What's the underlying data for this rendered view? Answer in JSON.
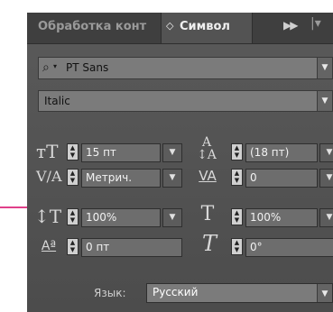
{
  "tabs": {
    "inactive_label": "Обработка конт",
    "active_label": "Символ",
    "active_arrows": "◇",
    "more": "▶▶",
    "menu": "|▾"
  },
  "font": {
    "family": "PT Sans",
    "style": "Italic"
  },
  "size": {
    "value": "15 пт"
  },
  "leading": {
    "value": "(18 пт)"
  },
  "kerning": {
    "value": "Метрич."
  },
  "tracking": {
    "value": "0"
  },
  "vertical_scale": {
    "value": "100%"
  },
  "horizontal_scale": {
    "value": "100%"
  },
  "baseline_shift": {
    "value": "0 пт"
  },
  "skew": {
    "value": "0°"
  },
  "language": {
    "label": "Язык:",
    "value": "Русский"
  },
  "icons": {
    "size": "font-size-icon",
    "leading": "leading-icon",
    "kerning": "kerning-icon",
    "tracking": "tracking-icon",
    "vertical_scale": "vertical-scale-icon",
    "horizontal_scale": "horizontal-scale-icon",
    "baseline": "baseline-shift-icon",
    "skew": "skew-icon"
  },
  "colors": {
    "panel_bg": "#535353",
    "tab_bar": "#3f3f3f",
    "field_bg": "#6d6d6d",
    "accent_line": "#e0408a"
  }
}
